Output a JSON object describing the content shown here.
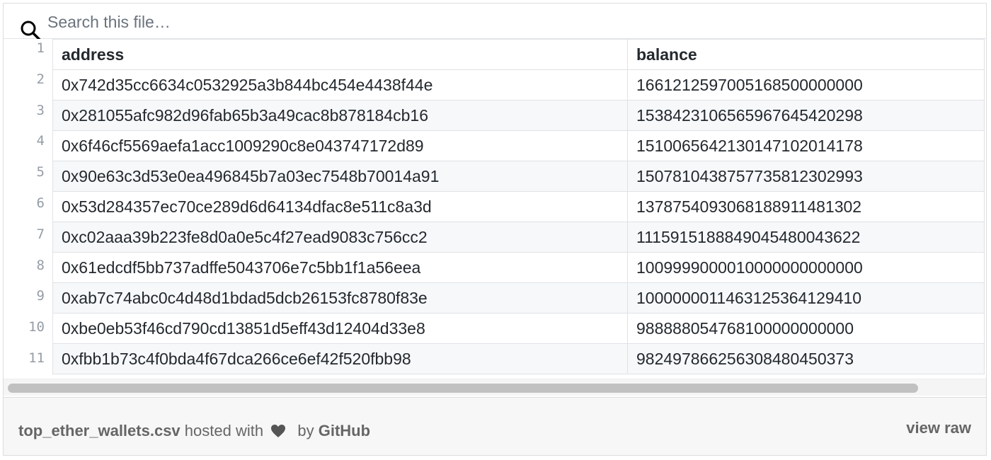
{
  "search": {
    "placeholder": "Search this file…"
  },
  "table": {
    "headers": [
      "address",
      "balance"
    ],
    "line_numbers": [
      "1",
      "2",
      "3",
      "4",
      "5",
      "6",
      "7",
      "8",
      "9",
      "10",
      "11"
    ],
    "rows": [
      [
        "0x742d35cc6634c0532925a3b844bc454e4438f44e",
        "1661212597005168500000000"
      ],
      [
        "0x281055afc982d96fab65b3a49cac8b878184cb16",
        "1538423106565967645420298"
      ],
      [
        "0x6f46cf5569aefa1acc1009290c8e043747172d89",
        "1510065642130147102014178"
      ],
      [
        "0x90e63c3d53e0ea496845b7a03ec7548b70014a91",
        "1507810438757735812302993"
      ],
      [
        "0x53d284357ec70ce289d6d64134dfac8e511c8a3d",
        "1378754093068188911481302"
      ],
      [
        "0xc02aaa39b223fe8d0a0e5c4f27ead9083c756cc2",
        "1115915188849045480043622"
      ],
      [
        "0x61edcdf5bb737adffe5043706e7c5bb1f1a56eea",
        "1009999000010000000000000"
      ],
      [
        "0xab7c74abc0c4d48d1bdad5dcb26153fc8780f83e",
        "1000000011463125364129410"
      ],
      [
        "0xbe0eb53f46cd790cd13851d5eff43d12404d33e8",
        "988888054768100000000000"
      ],
      [
        "0xfbb1b73c4f0bda4f67dca266ce6ef42f520fbb98",
        "982497866256308480450373"
      ]
    ]
  },
  "scrollbar": {
    "position": 0
  },
  "footer": {
    "filename": "top_ether_wallets.csv",
    "hosted_text": "hosted with",
    "heart_icon": "heart-icon",
    "by_text": "by",
    "github": "GitHub",
    "view_raw": "view raw"
  },
  "colors": {
    "footer_bg": "#f7f7f7",
    "row_stripe": "#f6f8fa",
    "border": "#dfe2e5",
    "text": "#24292e",
    "line_number": "#959da5"
  }
}
